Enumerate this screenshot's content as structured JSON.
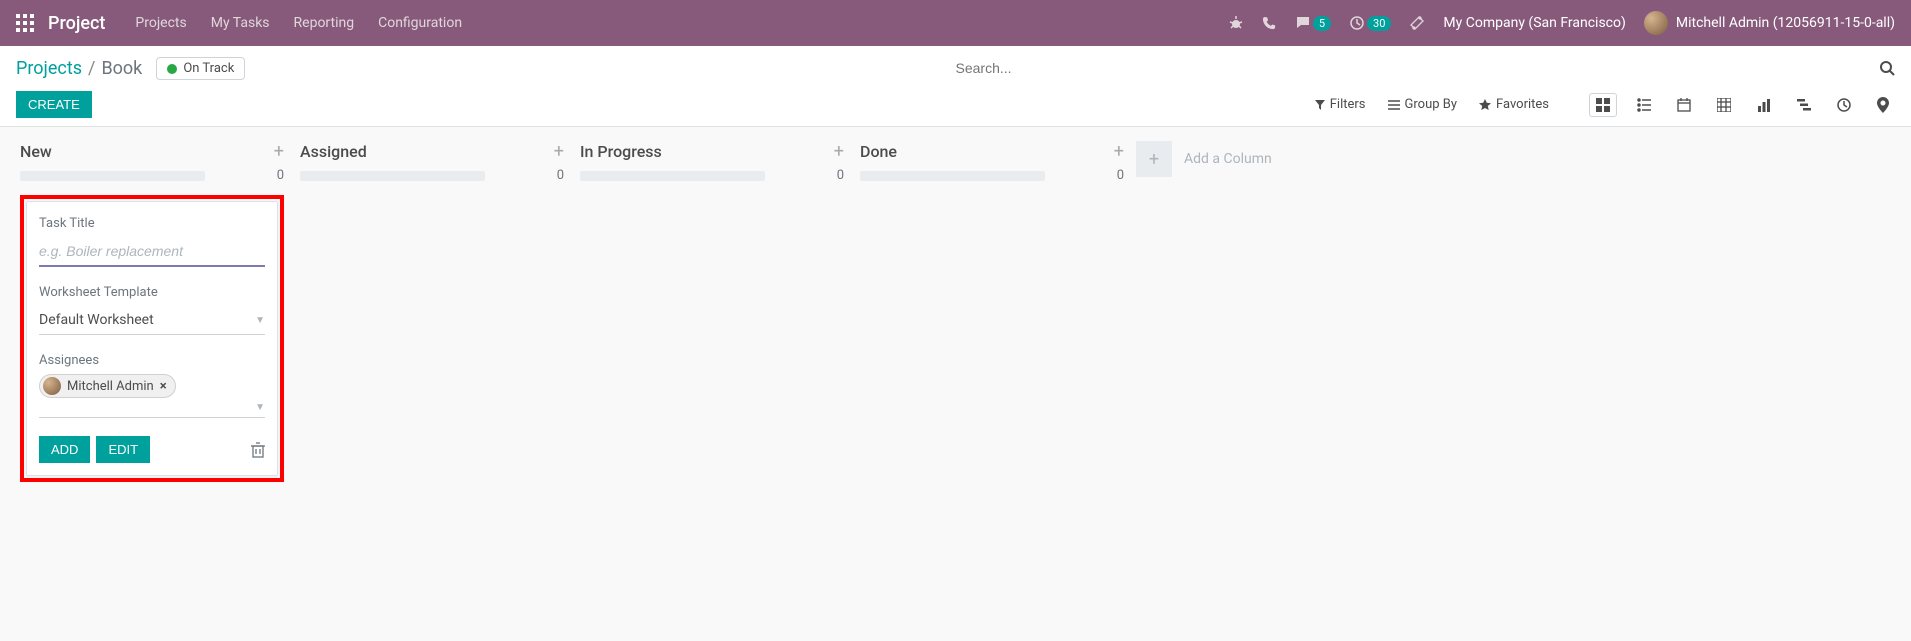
{
  "topbar": {
    "brand": "Project",
    "nav": [
      "Projects",
      "My Tasks",
      "Reporting",
      "Configuration"
    ],
    "messages_count": "5",
    "activities_count": "30",
    "company": "My Company (San Francisco)",
    "user": "Mitchell Admin (12056911-15-0-all)"
  },
  "breadcrumb": {
    "parent": "Projects",
    "current": "Book"
  },
  "status": {
    "label": "On Track"
  },
  "search": {
    "placeholder": "Search..."
  },
  "buttons": {
    "create": "CREATE",
    "add": "ADD",
    "edit": "EDIT"
  },
  "filters": {
    "filters": "Filters",
    "groupby": "Group By",
    "favorites": "Favorites"
  },
  "columns": [
    {
      "title": "New",
      "count": "0"
    },
    {
      "title": "Assigned",
      "count": "0"
    },
    {
      "title": "In Progress",
      "count": "0"
    },
    {
      "title": "Done",
      "count": "0"
    }
  ],
  "add_column": "Add a Column",
  "quick_form": {
    "title_label": "Task Title",
    "title_placeholder": "e.g. Boiler replacement",
    "worksheet_label": "Worksheet Template",
    "worksheet_value": "Default Worksheet",
    "assignees_label": "Assignees",
    "assignee_name": "Mitchell Admin"
  }
}
